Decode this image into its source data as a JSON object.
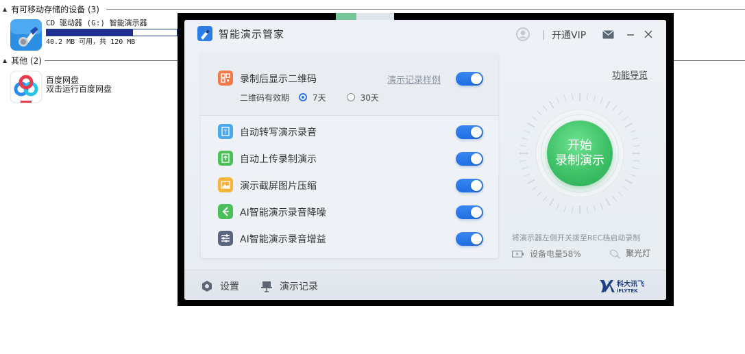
{
  "explorer": {
    "group_removable": "有可移动存储的设备 (3)",
    "cd_drive": {
      "name": "CD 驱动器 (G:) 智能演示器",
      "size_text": "40.2 MB 可用，共 120 MB",
      "used_fraction": 0.665
    },
    "group_other": "其他 (2)",
    "baidu": {
      "name": "百度网盘",
      "subtitle": "双击运行百度网盘"
    }
  },
  "app": {
    "title": "智能演示管家",
    "vip_label": "开通VIP",
    "func_guide": "功能导览",
    "qr_setting": {
      "label": "录制后显示二维码",
      "sample_link": "演示记录样例",
      "expiry_label": "二维码有效期",
      "options": [
        "7天",
        "30天"
      ],
      "selected": "7天",
      "enabled": true
    },
    "settings": [
      {
        "label": "自动转写演示录音",
        "enabled": true,
        "icon": "transcribe-icon",
        "color": "#4aa7ef"
      },
      {
        "label": "自动上传录制演示",
        "enabled": true,
        "icon": "upload-icon",
        "color": "#4cbf5c"
      },
      {
        "label": "演示截屏图片压缩",
        "enabled": true,
        "icon": "image-icon",
        "color": "#f5b43a"
      },
      {
        "label": "AI智能演示录音降噪",
        "enabled": true,
        "icon": "noise-reduce-icon",
        "color": "#4cbf5c"
      },
      {
        "label": "AI智能演示录音增益",
        "enabled": true,
        "icon": "gain-icon",
        "color": "#5d6680"
      }
    ],
    "record_button": {
      "line1": "开始",
      "line2": "录制演示"
    },
    "hint": "将演示器左侧开关拨至REC档启动录制",
    "battery": "设备电量58%",
    "spotlight": "聚光灯",
    "bottom": {
      "settings": "设置",
      "records": "演示记录"
    },
    "colors": {
      "accent": "#1f6fe3",
      "record": "#3ec167",
      "qr_icon": "#f07a4a"
    }
  }
}
